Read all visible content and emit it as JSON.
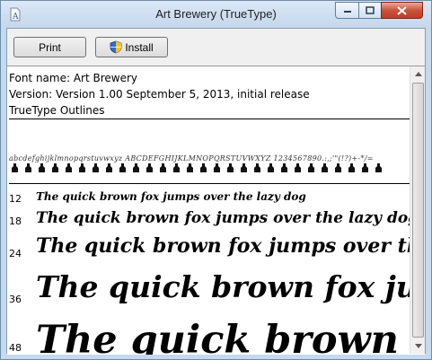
{
  "window": {
    "title": "Art Brewery (TrueType)"
  },
  "toolbar": {
    "print_label": "Print",
    "install_label": "Install"
  },
  "info": {
    "font_name": "Font name: Art Brewery",
    "version": "Version: Version 1.00 September 5, 2013, initial release",
    "type": "TrueType Outlines"
  },
  "charset": "abcdefghijklmnopqrstuvwxyz ABCDEFGHIJKLMNOPQRSTUVWXYZ 1234567890.:,;'\"(!?)+-*/=",
  "samples": [
    {
      "size": "12",
      "text": "The quick brown fox jumps over the lazy dog"
    },
    {
      "size": "18",
      "text": "The quick brown fox jumps over the lazy dog"
    },
    {
      "size": "24",
      "text": "The quick brown fox jumps over the lazy dog"
    },
    {
      "size": "36",
      "text": "The quick brown fox jumps over the lazy dog"
    },
    {
      "size": "48",
      "text": "The quick brown fox jumps over the lazy dog"
    }
  ],
  "icons": {
    "app": "font-file-icon",
    "minimize": "minimize-icon",
    "maximize": "maximize-icon",
    "close": "close-icon",
    "shield": "uac-shield-icon",
    "glyph": "missing-glyph-bottle-icon",
    "up": "scroll-up-arrow-icon",
    "down": "scroll-down-arrow-icon"
  },
  "colors": {
    "close_button": "#c23b22",
    "titlebar": "#c4d7ec"
  }
}
